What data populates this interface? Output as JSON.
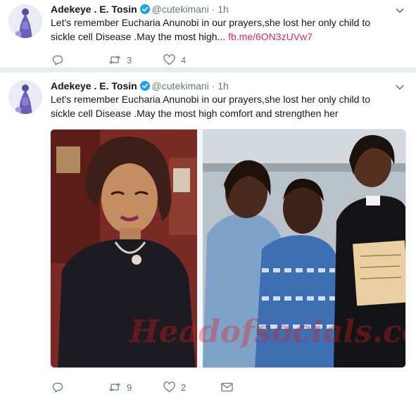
{
  "tweets": [
    {
      "author_name": "Adekeye . E. Tosin",
      "handle": "@cutekimani",
      "separator": "·",
      "time": "1h",
      "text": "Let's remember Eucharia Anunobi in our prayers,she lost her only child to sickle cell Disease  .May the most high... ",
      "link": "fb.me/6ON3zUVw7",
      "retweet_count": "3",
      "like_count": "4"
    },
    {
      "author_name": "Adekeye . E. Tosin",
      "handle": "@cutekimani",
      "separator": "·",
      "time": "1h",
      "text": "Let's remember Eucharia Anunobi in our prayers,she lost her only child to sickle cell Disease  .May the most high comfort and strengthen her",
      "watermark": "Headofsocials.co",
      "retweet_count": "9",
      "like_count": "2"
    }
  ],
  "colors": {
    "link": "#e0245e",
    "verified": "#1da1f2",
    "icon_gray": "#657786"
  },
  "icons": [
    "verified-icon",
    "chevron-down-icon",
    "reply-icon",
    "retweet-icon",
    "like-icon",
    "message-icon"
  ]
}
